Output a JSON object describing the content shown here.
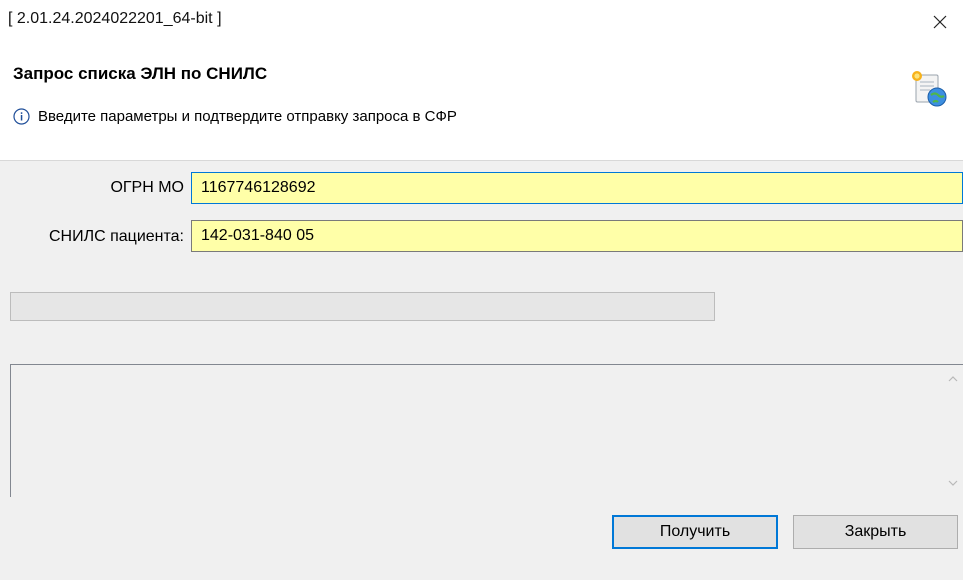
{
  "window": {
    "title": "[ 2.01.24.2024022201_64-bit ]",
    "close_icon": "close-icon"
  },
  "header": {
    "title": "Запрос списка ЭЛН по СНИЛС",
    "info_text": "Введите параметры и подтвердите отправку запроса в СФР",
    "info_icon": "info-icon",
    "dialog_icon": "document-globe-icon"
  },
  "form": {
    "ogrn_label": "ОГРН МО",
    "ogrn_value": "1167746128692",
    "snils_label": "СНИЛС пациента:",
    "snils_value": "142-031-840 05",
    "input_bg_color": "#ffffa8",
    "focus_color": "#0078d7"
  },
  "progress": {
    "value": 0
  },
  "log": {
    "text": ""
  },
  "buttons": {
    "get_label": "Получить",
    "close_label": "Закрыть"
  }
}
